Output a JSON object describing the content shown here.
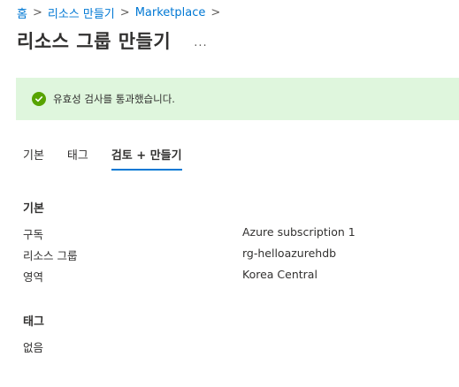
{
  "breadcrumb": {
    "items": [
      "홈",
      "리소스 만들기",
      "Marketplace"
    ],
    "separator": ">"
  },
  "header": {
    "title": "리소스 그룹 만들기",
    "more_label": "..."
  },
  "banner": {
    "status": "success",
    "icon": "check-circle-icon",
    "text": "유효성 검사를 통과했습니다."
  },
  "tabs": [
    {
      "label": "기본",
      "active": false
    },
    {
      "label": "태그",
      "active": false
    },
    {
      "label": "검토 + 만들기",
      "active": true
    }
  ],
  "basics": {
    "heading": "기본",
    "rows": [
      {
        "label": "구독",
        "value": "Azure subscription 1"
      },
      {
        "label": "리소스 그룹",
        "value": "rg-helloazurehdb"
      },
      {
        "label": "영역",
        "value": "Korea Central"
      }
    ]
  },
  "tags": {
    "heading": "태그",
    "empty_text": "없음"
  },
  "colors": {
    "link": "#0078d4",
    "success_bg": "#dff6dd",
    "success_icon": "#57a300",
    "tab_underline": "#0078d4"
  }
}
